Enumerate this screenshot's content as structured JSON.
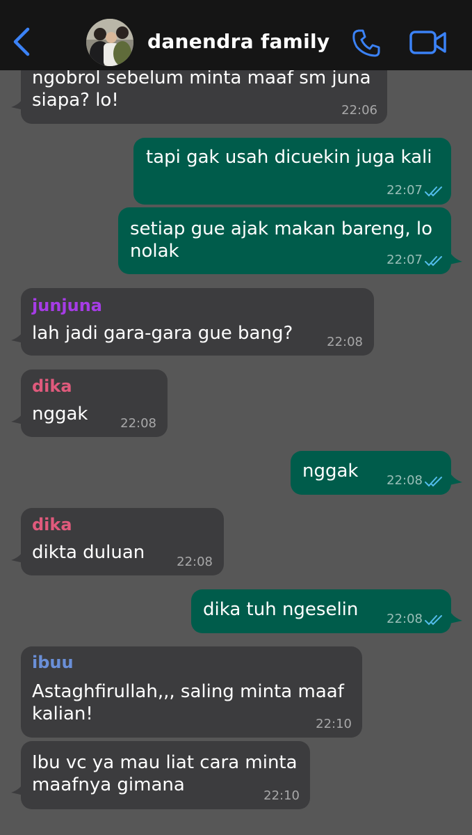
{
  "header": {
    "chat_title": "danendra family"
  },
  "colors": {
    "accent_blue": "#3b82f6",
    "header_bg": "#151515",
    "chat_bg": "#575757",
    "incoming_bubble": "#3c3c3e",
    "outgoing_bubble": "#005c4b",
    "read_ticks": "#53bdeb",
    "sender_junjuna": "#a63ce6",
    "sender_dika": "#e05a7c",
    "sender_ibuu": "#6a8fd8"
  },
  "messages": [
    {
      "direction": "in",
      "sender": "",
      "text": "ngobrol sebelum minta maaf sm juna\nsiapa? lo!",
      "time": "22:06"
    },
    {
      "direction": "out",
      "text": "tapi gak usah dicuekin juga kali",
      "time": "22:07",
      "status_icon": "double-check-read-icon"
    },
    {
      "direction": "out",
      "text": "setiap gue ajak makan bareng, lo\nnolak",
      "time": "22:07",
      "status_icon": "double-check-read-icon"
    },
    {
      "direction": "in",
      "sender": "junjuna",
      "text": "lah jadi gara-gara gue bang?",
      "time": "22:08"
    },
    {
      "direction": "in",
      "sender": "dika",
      "text": "nggak",
      "time": "22:08"
    },
    {
      "direction": "out",
      "text": "nggak",
      "time": "22:08",
      "status_icon": "double-check-read-icon"
    },
    {
      "direction": "in",
      "sender": "dika",
      "text": "dikta duluan",
      "time": "22:08"
    },
    {
      "direction": "out",
      "text": "dika tuh ngeselin",
      "time": "22:08",
      "status_icon": "double-check-read-icon"
    },
    {
      "direction": "in",
      "sender": "ibuu",
      "text": "Astaghfirullah,,, saling minta maaf\nkalian!",
      "time": "22:10"
    },
    {
      "direction": "in",
      "sender": "",
      "text": "Ibu vc ya mau liat cara minta\nmaafnya gimana",
      "time": "22:10"
    }
  ]
}
